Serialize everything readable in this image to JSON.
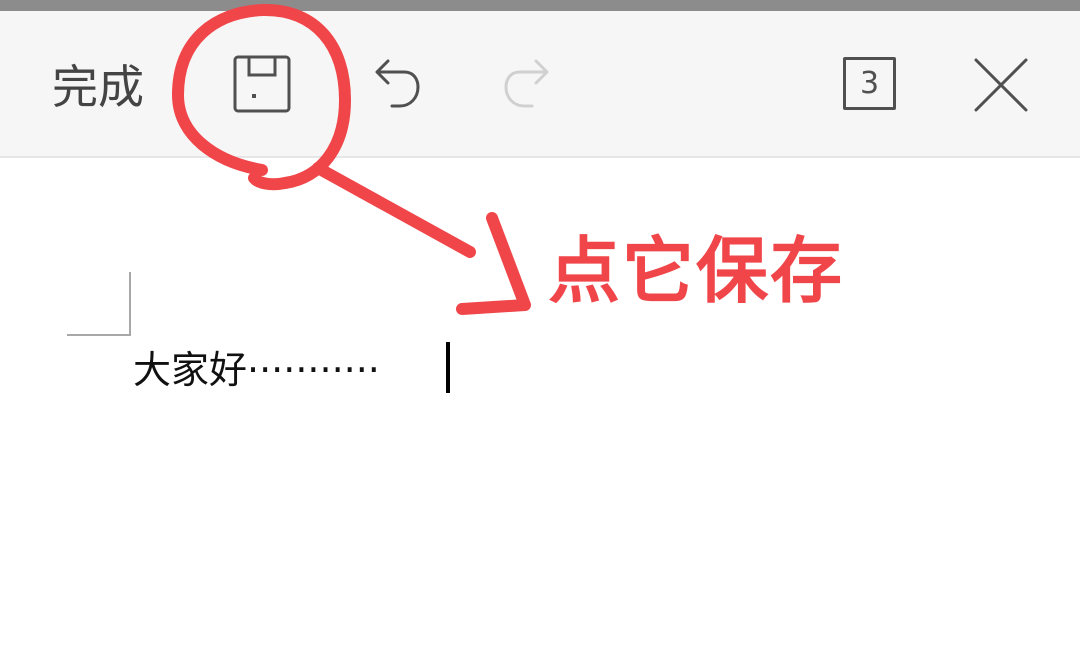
{
  "toolbar": {
    "done_label": "完成",
    "page_count": "3",
    "icons": {
      "save": "save-icon",
      "undo": "undo-icon",
      "redo": "redo-icon",
      "close": "close-icon"
    },
    "redo_enabled": false
  },
  "document": {
    "text": "大家好",
    "dots": "···········"
  },
  "annotation": {
    "label": "点它保存",
    "color": "#f0464a"
  }
}
